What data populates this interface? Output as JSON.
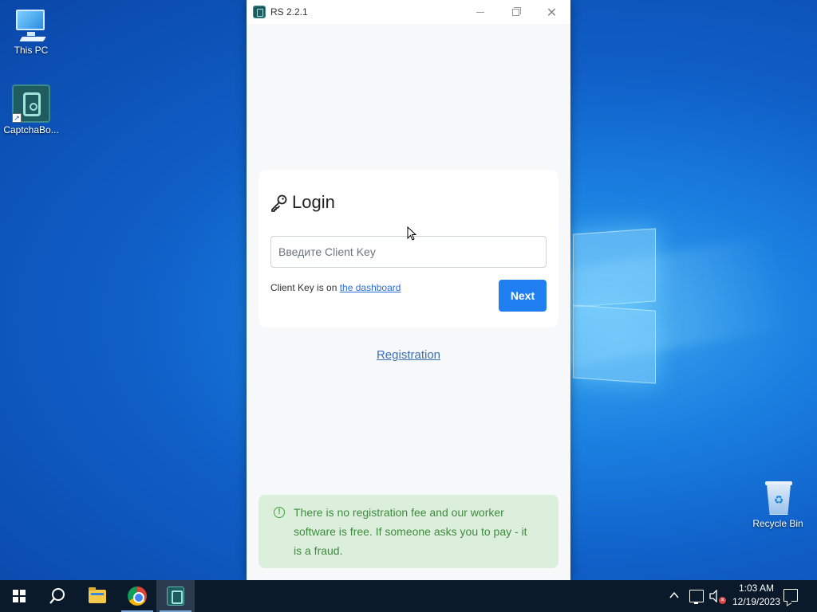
{
  "desktop": {
    "icons": [
      {
        "label": "This PC",
        "icon": "computer-icon"
      },
      {
        "label": "CaptchaBo...",
        "icon": "captchabot-icon"
      },
      {
        "label": "Recycle Bin",
        "icon": "recycle-bin-icon"
      }
    ]
  },
  "window": {
    "title": "RS 2.2.1",
    "icon": "app-logo-icon"
  },
  "login": {
    "heading": "Login",
    "heading_icon": "key-icon",
    "input_placeholder": "Введите Client Key",
    "input_value": "",
    "hint_prefix": "Client Key is on ",
    "hint_link": "the dashboard",
    "next_label": "Next"
  },
  "registration_link": "Registration",
  "alert": {
    "icon": "info-circle-icon",
    "text": "There is no registration fee and our worker software is free. If someone asks you to pay - it is a fraud."
  },
  "taskbar": {
    "items": [
      "start-icon",
      "search-icon",
      "file-explorer-icon",
      "chrome-icon",
      "captchabot-icon"
    ],
    "clock_time": "1:03 AM",
    "clock_date": "12/19/2023"
  },
  "colors": {
    "accent": "#1f7ff0",
    "link": "#3b6fb6",
    "alert_bg": "#dcefdc",
    "alert_text": "#3f8a3f"
  }
}
